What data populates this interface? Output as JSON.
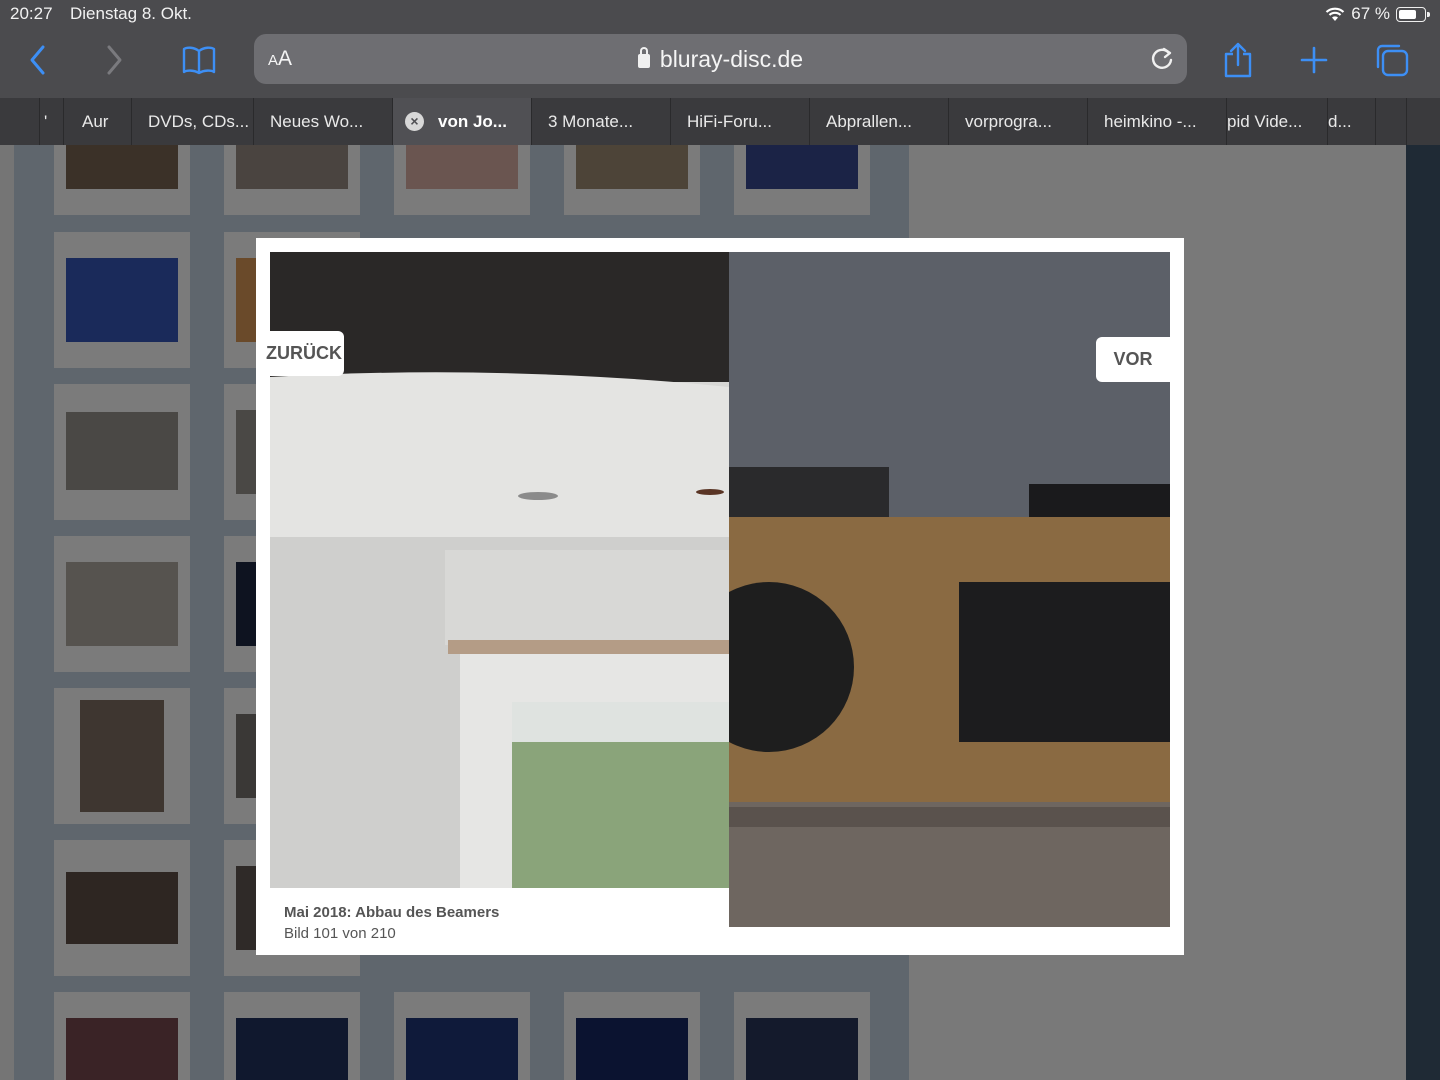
{
  "status": {
    "time": "20:27",
    "date": "Dienstag 8. Okt.",
    "battery": "67 %",
    "battery_level": 0.67
  },
  "toolbar": {
    "aa_label_small": "A",
    "aa_label_big": "A",
    "url": "bluray-disc.de"
  },
  "tabs": [
    {
      "label": "'"
    },
    {
      "label": "Aur"
    },
    {
      "label": "DVDs, CDs..."
    },
    {
      "label": "Neues Wo..."
    },
    {
      "label": "von Jo...",
      "active": true
    },
    {
      "label": "3 Monate..."
    },
    {
      "label": "HiFi-Foru..."
    },
    {
      "label": "Abprallen..."
    },
    {
      "label": "vorprogra..."
    },
    {
      "label": "heimkino -..."
    },
    {
      "label": "pid Vide..."
    },
    {
      "label": "d..."
    }
  ],
  "lightbox": {
    "prev_label": "ZURÜCK",
    "next_label": "VOR",
    "caption_title": "Mai 2018: Abbau des Beamers",
    "caption_counter": "Bild 101 von 210"
  },
  "colors": {
    "accent": "#3d8ff5",
    "page_overlay": "#757575",
    "tab_bar": "#3a3a3d"
  }
}
